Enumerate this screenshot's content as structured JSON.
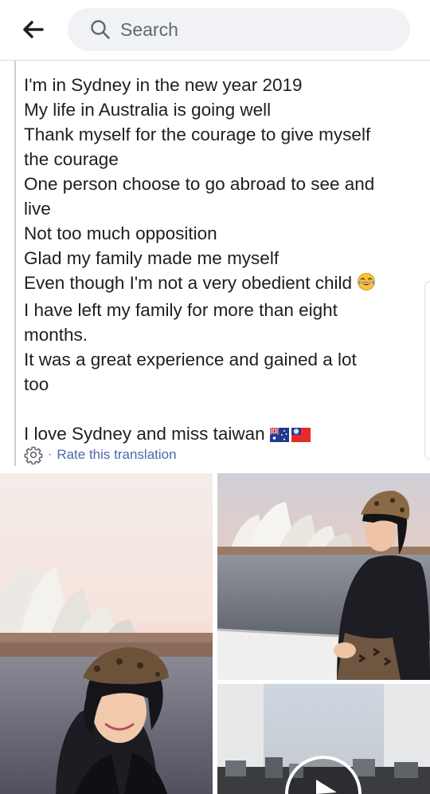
{
  "header": {
    "back_icon": "arrow-left-icon",
    "search_icon": "magnifier-icon",
    "search_placeholder": "Search"
  },
  "post": {
    "lines": [
      "I'm in Sydney in the new year 2019",
      "My life in Australia is going well",
      "Thank myself for the courage to give myself",
      "the courage",
      "One person choose to go abroad to see and",
      "live",
      "Not too much opposition",
      "Glad my family made me myself",
      "Even though I'm not a very obedient child",
      "I have left my family for more than eight",
      "months.",
      "It was a great experience and gained a lot",
      "too",
      "",
      "I love Sydney and miss taiwan"
    ],
    "emoji_child_line": "tears-of-joy-emoji",
    "flags": [
      "australia-flag",
      "taiwan-flag"
    ],
    "translation": {
      "icon": "gear-icon",
      "separator": "·",
      "rate_label": "Rate this translation"
    }
  },
  "photos": [
    {
      "name": "photo-woman-beret-opera-house",
      "type": "image"
    },
    {
      "name": "photo-woman-seated-harbor",
      "type": "image"
    },
    {
      "name": "video-thumbnail-city",
      "type": "video",
      "icon": "play-icon"
    }
  ],
  "colors": {
    "text": "#1c1e21",
    "link": "#4b6aa8",
    "search_bg": "#f0f2f5",
    "divider": "#dadde1"
  }
}
